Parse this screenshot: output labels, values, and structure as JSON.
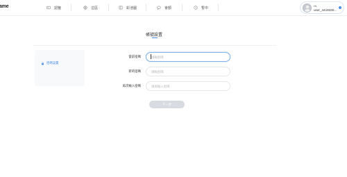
{
  "header": {
    "brand": "ame",
    "nav": [
      {
        "label": "認籤",
        "icon": "id-card-icon"
      },
      {
        "label": "這區",
        "icon": "globe-icon"
      },
      {
        "label": "彩池圖",
        "icon": "grid-icon"
      },
      {
        "label": "會額",
        "icon": "chat-icon"
      },
      {
        "label": "暫中",
        "icon": "clock-icon"
      }
    ],
    "user": {
      "greeting": "Hi,",
      "name": "user_4419330...",
      "status_color": "#4a90e2"
    }
  },
  "page": {
    "title": "帳號設置",
    "accent": "#4a90e2"
  },
  "sidebar": {
    "items": [
      {
        "label": "密碼設置",
        "icon": "lock-icon",
        "active": true
      }
    ]
  },
  "form": {
    "fields": [
      {
        "label": "當前密碼",
        "placeholder": "請輸密碼",
        "value": "",
        "focused": true
      },
      {
        "label": "新的密碼",
        "placeholder": "請輸密碼",
        "value": ""
      },
      {
        "label": "再次輸入密碼",
        "placeholder": "請再輸入密碼",
        "value": ""
      }
    ],
    "submit_label": "下一步"
  }
}
